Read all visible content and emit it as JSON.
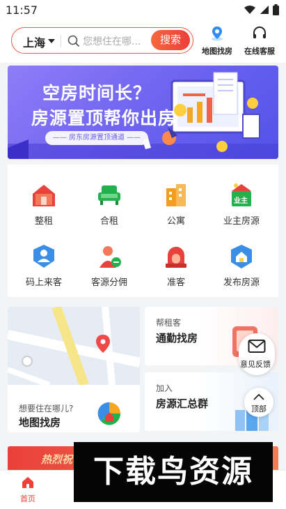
{
  "status_bar": {
    "time": "11:57"
  },
  "header": {
    "city": "上海",
    "search_placeholder": "您想住在哪...",
    "search_button": "搜索",
    "map_search_label": "地图找房",
    "online_service_label": "在线客服"
  },
  "banner": {
    "line1": "空房时间长？",
    "line2": "房源置顶帮你出房",
    "pill": "—— 房东房源置顶通道 ——"
  },
  "grid": [
    {
      "label": "整租",
      "icon": "house-icon",
      "color": "#e8423c"
    },
    {
      "label": "合租",
      "icon": "sofa-icon",
      "color": "#22b14c"
    },
    {
      "label": "公寓",
      "icon": "building-icon",
      "color": "#f59a23"
    },
    {
      "label": "业主房源",
      "icon": "owner-badge-icon",
      "color": "#22b14c",
      "badge": "业主"
    },
    {
      "label": "码上来客",
      "icon": "qr-person-icon",
      "color": "#3a8ee6"
    },
    {
      "label": "客源分佣",
      "icon": "agent-coin-icon",
      "color": "#e8423c"
    },
    {
      "label": "准客",
      "icon": "alarm-light-icon",
      "color": "#e8423c"
    },
    {
      "label": "发布房源",
      "icon": "publish-house-icon",
      "color": "#3a8ee6"
    }
  ],
  "features": {
    "map_card": {
      "subtitle": "想要住在哪儿?",
      "title": "地图找房"
    },
    "commute_card": {
      "subtitle": "帮租客",
      "title": "通勤找房"
    },
    "group_card": {
      "subtitle": "加入",
      "title": "房源汇总群"
    }
  },
  "floating": {
    "feedback_label": "意见反馈",
    "top_label": "顶部"
  },
  "promo": {
    "text": "热烈祝"
  },
  "bottom_nav": {
    "home_label": "首页"
  },
  "watermark": {
    "text": "下载鸟资源"
  },
  "colors": {
    "accent": "#ee3f3b",
    "banner_purple": "#6b62f0"
  }
}
